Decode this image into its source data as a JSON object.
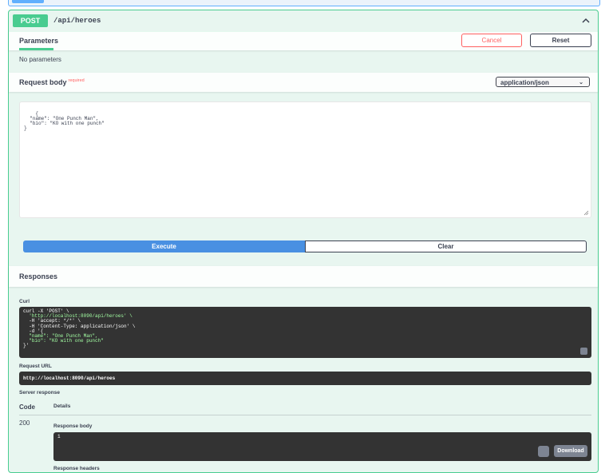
{
  "operation": {
    "method": "POST",
    "path": "/api/heroes"
  },
  "parameters": {
    "title": "Parameters",
    "cancel_label": "Cancel",
    "reset_label": "Reset",
    "empty_text": "No parameters"
  },
  "request_body": {
    "title": "Request body",
    "required_label": "required",
    "content_type": "application/json",
    "value": "{\n  \"name\": \"One Punch Man\",\n  \"bio\": \"KO with one punch\"\n}"
  },
  "actions": {
    "execute_label": "Execute",
    "clear_label": "Clear"
  },
  "responses": {
    "title": "Responses",
    "curl_label": "Curl",
    "curl_lines": [
      "curl -X 'POST' \\",
      "  'http://localhost:8090/api/heroes' \\",
      "  -H 'accept: */*' \\",
      "  -H 'Content-Type: application/json' \\",
      "  -d '{",
      "  \"name\": \"One Punch Man\",",
      "  \"bio\": \"KO with one punch\"",
      "}'"
    ],
    "request_url_label": "Request URL",
    "request_url": "http://localhost:8090/api/heroes",
    "server_response_label": "Server response",
    "code_header": "Code",
    "details_header": "Details",
    "status_code": "200",
    "response_body_label": "Response body",
    "response_body": "1",
    "download_label": "Download",
    "response_headers_label": "Response headers"
  },
  "colors": {
    "post_accent": "#49cc90",
    "execute_blue": "#4990e2",
    "cancel_red": "#ff6060",
    "code_bg": "#333333"
  },
  "icons": {
    "collapse": "chevron-up-icon",
    "copy": "copy-icon",
    "resize": "resize-grip-icon",
    "select_arrow": "chevron-down-icon"
  }
}
